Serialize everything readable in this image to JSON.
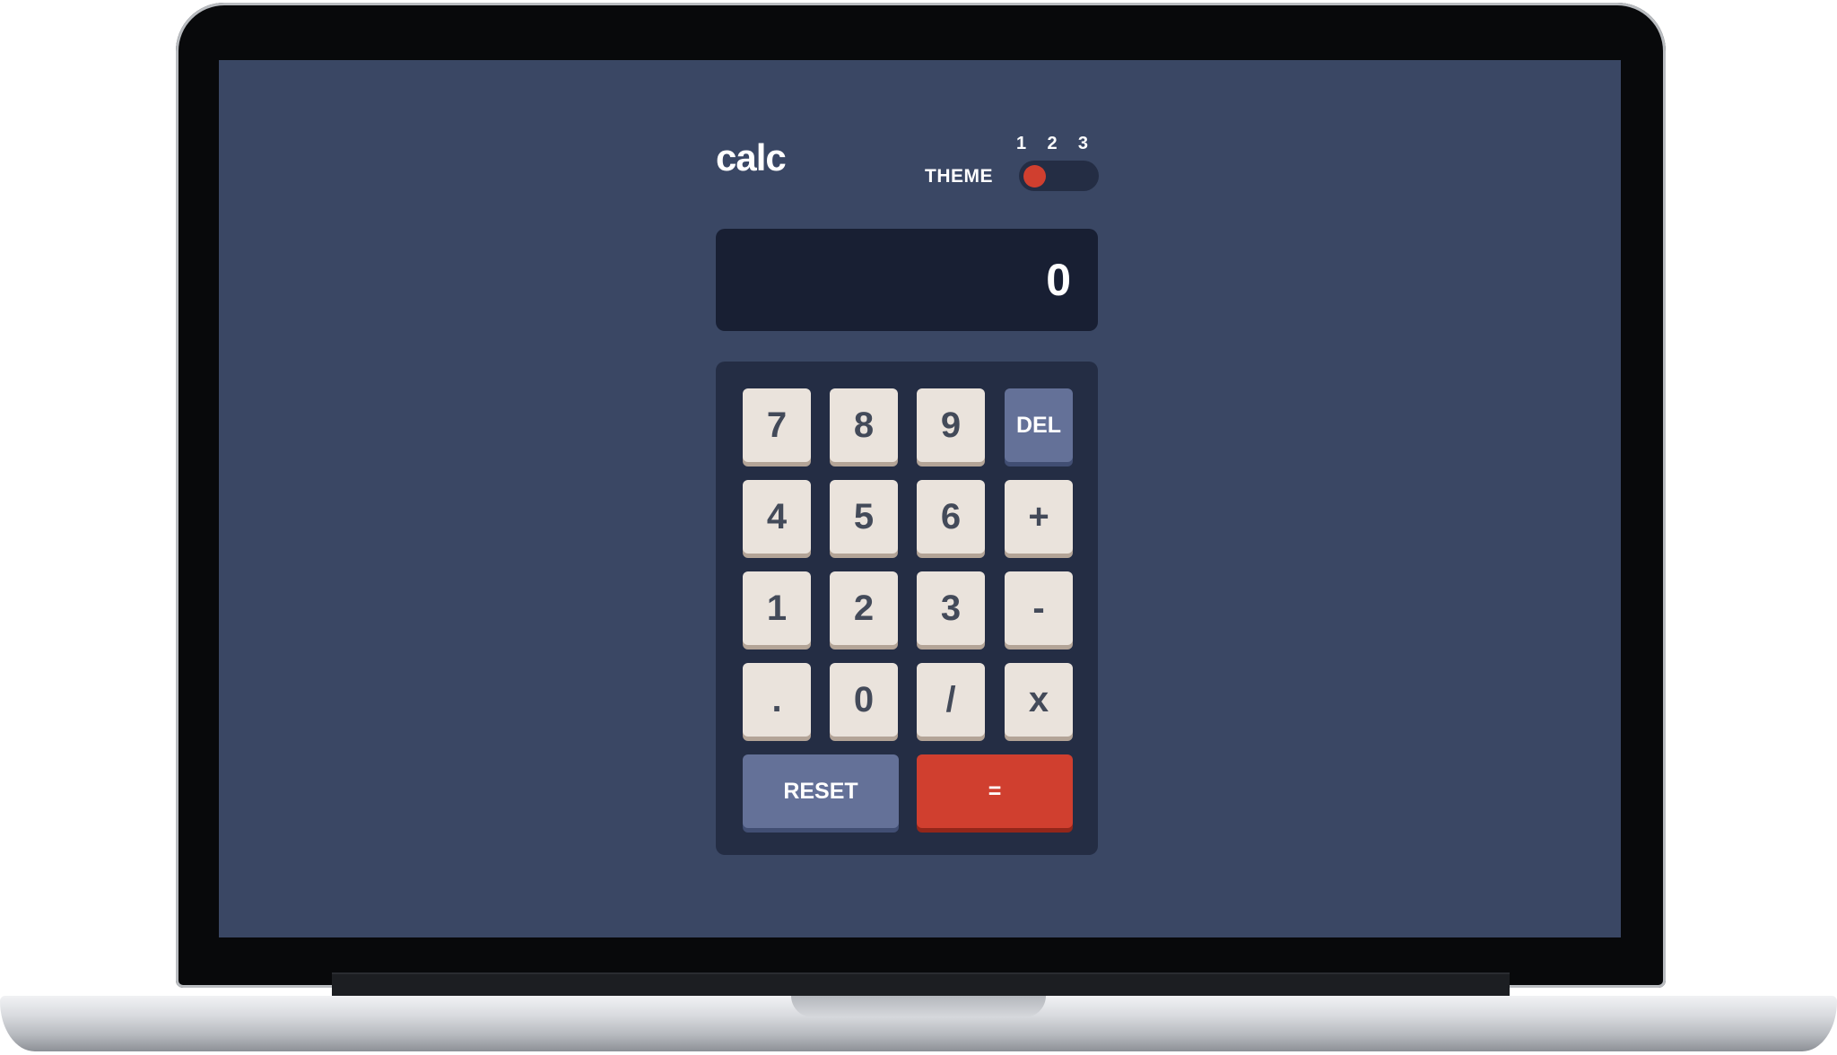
{
  "app": {
    "title": "calc",
    "theme_label": "THEME",
    "theme_options": [
      "1",
      "2",
      "3"
    ],
    "theme_selected": 1
  },
  "display": {
    "value": "0"
  },
  "keypad": {
    "row1": [
      "7",
      "8",
      "9",
      "DEL"
    ],
    "row2": [
      "4",
      "5",
      "6",
      "+"
    ],
    "row3": [
      "1",
      "2",
      "3",
      "-"
    ],
    "row4": [
      ".",
      "0",
      "/",
      "x"
    ],
    "reset": "RESET",
    "equals": "="
  },
  "colors": {
    "background": "#3a4764",
    "keypad_background": "#242d44",
    "display_background": "#181f33",
    "key": "#eae3dc",
    "key_text": "#434a59",
    "key_blue": "#647198",
    "key_red": "#d03f2f"
  }
}
